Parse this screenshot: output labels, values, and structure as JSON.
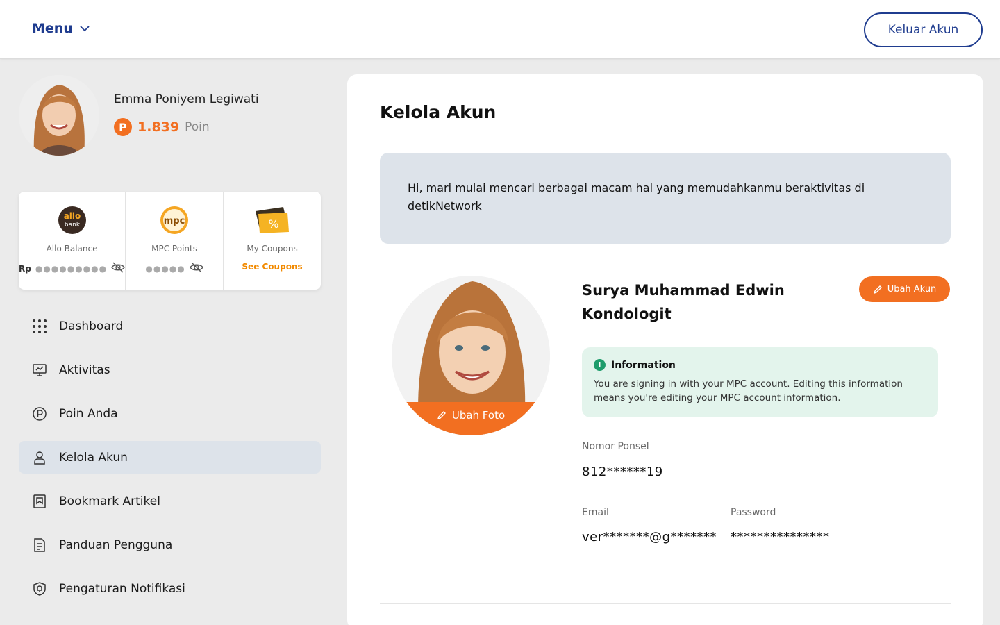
{
  "header": {
    "menu_label": "Menu",
    "logout_label": "Keluar Akun"
  },
  "profile": {
    "name": "Emma Poniyem Legiwati",
    "points_badge": "P",
    "points": "1.839",
    "points_unit": "Poin"
  },
  "wallet": {
    "allo": {
      "label": "Allo Balance",
      "currency": "Rp",
      "masked": "●●●●●●●●●"
    },
    "mpc": {
      "label": "MPC Points",
      "masked": "●●●●●"
    },
    "coupons": {
      "label": "My Coupons",
      "link": "See Coupons"
    }
  },
  "nav": {
    "items": [
      {
        "label": "Dashboard",
        "icon": "grid-dots-icon"
      },
      {
        "label": "Aktivitas",
        "icon": "monitor-icon"
      },
      {
        "label": "Poin Anda",
        "icon": "points-circle-icon"
      },
      {
        "label": "Kelola Akun",
        "icon": "user-icon",
        "active": true
      },
      {
        "label": "Bookmark Artikel",
        "icon": "bookmark-icon"
      },
      {
        "label": "Panduan Pengguna",
        "icon": "guide-icon"
      },
      {
        "label": "Pengaturan Notifikasi",
        "icon": "shield-bell-icon"
      }
    ]
  },
  "main": {
    "title": "Kelola Akun",
    "greeting": "Hi, mari mulai mencari berbagai macam hal yang memudahkanmu beraktivitas di detikNetwork",
    "change_photo_label": "Ubah Foto",
    "user_name": "Surya Muhammad Edwin Kondologit",
    "edit_account_label": "Ubah Akun",
    "info_title": "Information",
    "info_icon_char": "i",
    "info_text": "You are signing in with your MPC account. Editing this information means you're editing your MPC account information.",
    "phone_label": "Nomor Ponsel",
    "phone_value": "812******19",
    "email_label": "Email",
    "email_value": "ver*******@g*******",
    "password_label": "Password",
    "password_value": "***************"
  },
  "colors": {
    "primary": "#1f3c8f",
    "accent": "#f26f21",
    "info_bg": "#e3f4ec",
    "active_nav": "#dde3ea"
  }
}
